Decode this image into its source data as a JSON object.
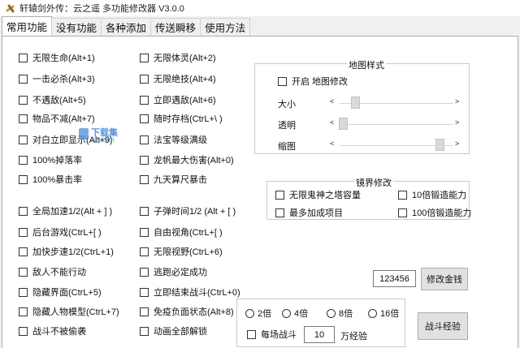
{
  "window": {
    "title": "轩辕剑外传：云之遥 多功能修改器 V3.0.0",
    "icon": "sword-icon"
  },
  "tabs": [
    {
      "label": "常用功能",
      "active": true
    },
    {
      "label": "没有功能"
    },
    {
      "label": "各种添加"
    },
    {
      "label": "传送瞬移"
    },
    {
      "label": "使用方法"
    }
  ],
  "col1": [
    "无限生命(Alt+1)",
    "一击必杀(Alt+3)",
    "不遇敌(Alt+5)",
    "物品不减(Alt+7)",
    "对白立即显示(Alt+9)",
    "100%掉落率",
    "100%暴击率",
    "全局加速1/2(Alt + ] )",
    "后台游戏(CtrL+[ )",
    "加快步速1/2(CtrL+1)",
    "敌人不能行动",
    "隐藏界面(CtrL+5)",
    "隐藏人物模型(CtrL+7)",
    "战斗不被偷袭"
  ],
  "col2": [
    "无限体灵(Alt+2)",
    "无限绝技(Alt+4)",
    "立即遇敌(Alt+6)",
    "随时存档(CtrL+\\ )",
    "法宝等级满级",
    "龙帆最大伤害(Alt+0)",
    "九天算尺暴击",
    "子弹时间1/2 (Alt + [ )",
    "自由视角(CtrL+[ )",
    "无限视野(CtrL+6)",
    "逃跑必定成功",
    "立即结束战斗(CtrL+0)",
    "免疫负面状态(Alt+8)",
    "动画全部解锁"
  ],
  "map_group": {
    "title": "地图样式",
    "enable_label": "开启 地图修改",
    "sliders": [
      {
        "label": "大小",
        "value": 0.1
      },
      {
        "label": "透明",
        "value": 0.0
      },
      {
        "label": "缩图",
        "value": 0.97
      }
    ]
  },
  "realm_group": {
    "title": "镜界修改",
    "items": [
      "无限鬼神之塔容量",
      "10倍锻造能力",
      "最多加成项目",
      "100倍锻造能力"
    ]
  },
  "money": {
    "value": "123456",
    "button": "修改金钱"
  },
  "battle": {
    "multipliers": [
      "2倍",
      "4倍",
      "8倍",
      "16倍"
    ],
    "per_battle_label": "每场战斗",
    "exp_value": "10",
    "exp_unit": "万经验",
    "button": "战斗经验"
  },
  "watermark": {
    "title": "下载集",
    "url": "xzji.com"
  }
}
